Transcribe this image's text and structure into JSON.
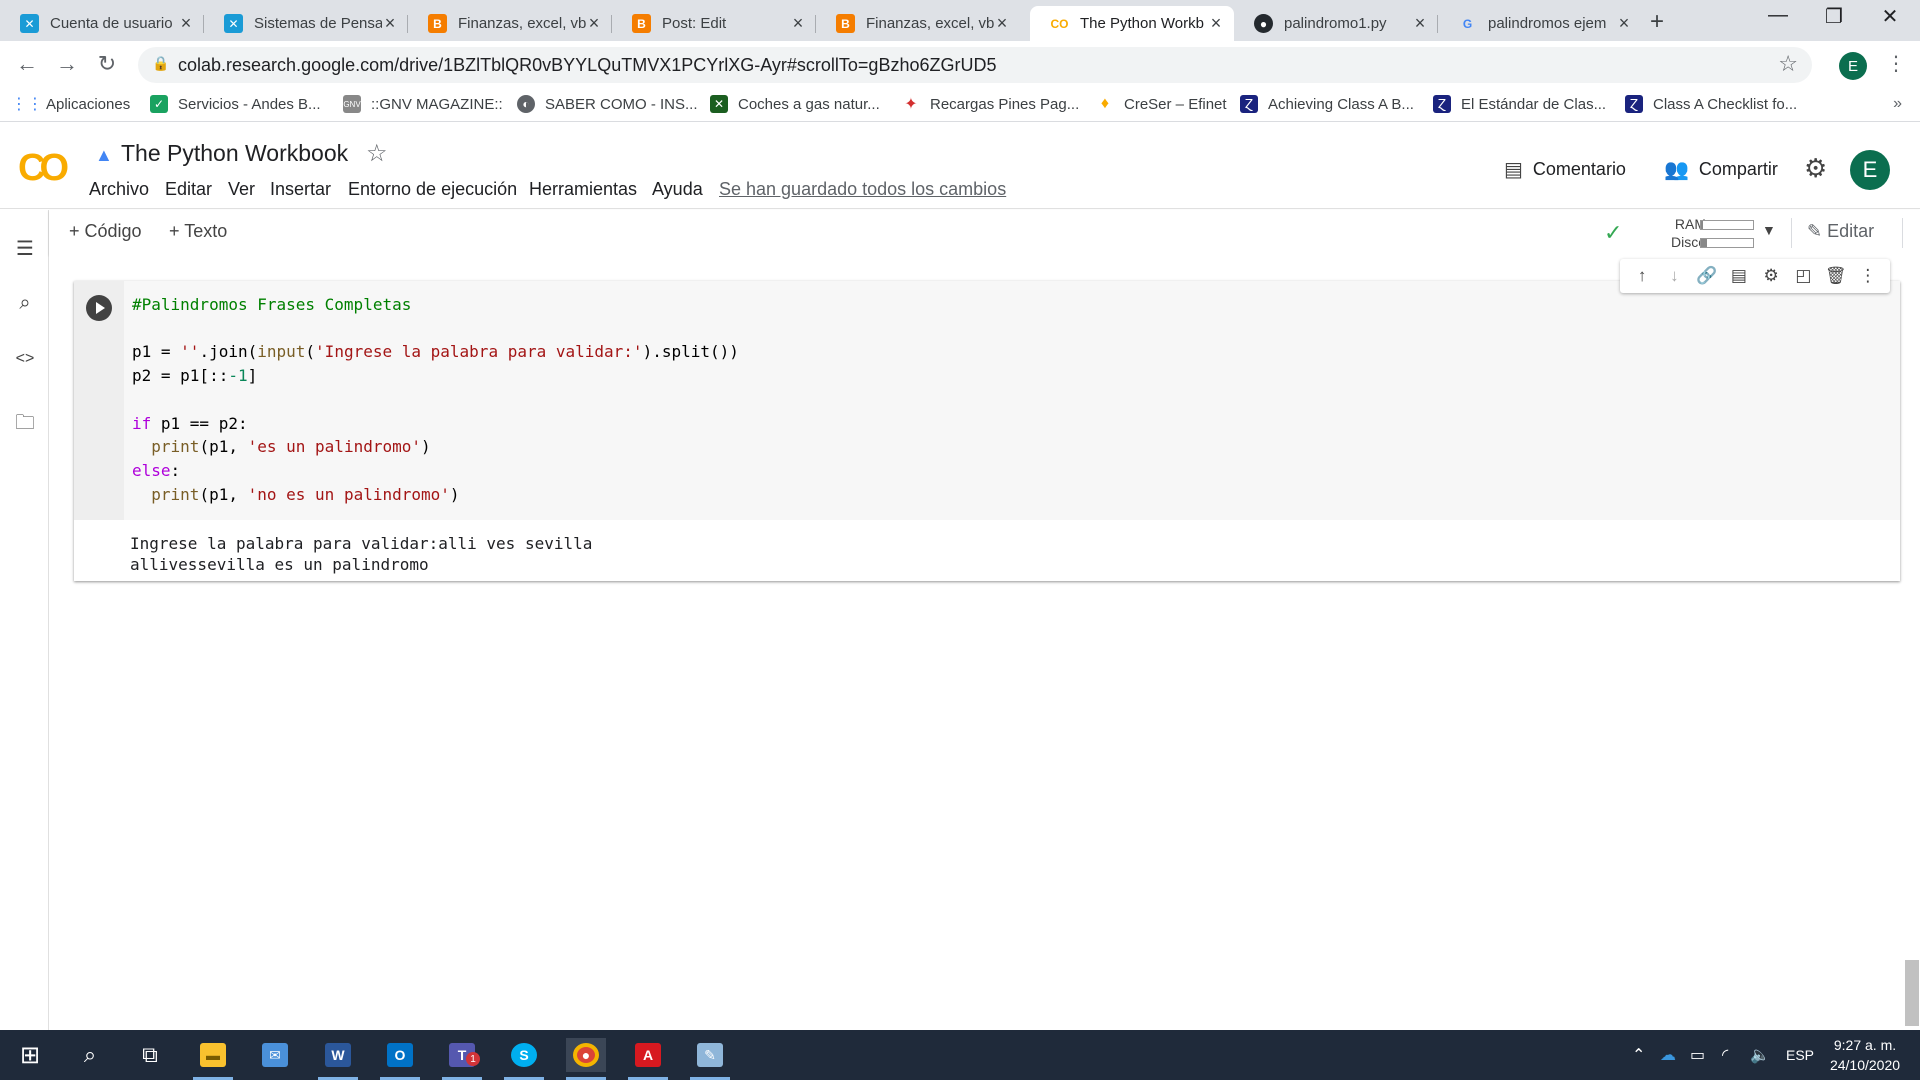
{
  "browser": {
    "tabs": [
      {
        "title": "Cuenta de usuario",
        "icon": "xinco-icon"
      },
      {
        "title": "Sistemas de Pensa",
        "icon": "xinco-icon"
      },
      {
        "title": "Finanzas, excel, vb",
        "icon": "blogger-icon"
      },
      {
        "title": "Post: Edit",
        "icon": "blogger-icon"
      },
      {
        "title": "Finanzas, excel, vb",
        "icon": "blogger-icon"
      },
      {
        "title": "The Python Workb",
        "icon": "colab-icon",
        "active": true
      },
      {
        "title": "palindromo1.py",
        "icon": "github-icon"
      },
      {
        "title": "palindromos ejem",
        "icon": "google-icon"
      }
    ],
    "url": "colab.research.google.com/drive/1BZlTblQR0vBYYLQuTMVX1PCYrlXG-Ayr#scrollTo=gBzho6ZGrUD5",
    "profile_initial": "E",
    "bookmarks": [
      "Aplicaciones",
      "Servicios - Andes B...",
      "::GNV MAGAZINE::",
      "SABER COMO - INS...",
      "Coches a gas natur...",
      "Recargas Pines Pag...",
      "CreSer – Efinet",
      "Achieving Class A B...",
      "El Estándar de Clas...",
      "Class A Checklist fo..."
    ],
    "bookmarks_more": "»"
  },
  "colab": {
    "logo": "CO",
    "title": "The Python Workbook",
    "menu": [
      "Archivo",
      "Editar",
      "Ver",
      "Insertar",
      "Entorno de ejecución",
      "Herramientas",
      "Ayuda"
    ],
    "saved_status": "Se han guardado todos los cambios",
    "comment_label": "Comentario",
    "share_label": "Compartir",
    "account_initial": "E",
    "toolbar": {
      "add_code": "+ Código",
      "add_text": "+ Texto",
      "ram_label": "RAM",
      "disk_label": "Disco",
      "ram_fill": 0.04,
      "disk_fill": 0.12,
      "edit_label": "Editar"
    }
  },
  "cell": {
    "code_lines": [
      "#Palindromos Frases Completas",
      "",
      "p1 = ''.join(input('Ingrese la palabra para validar:').split())",
      "p2 = p1[::-1]",
      "",
      "if p1 == p2:",
      "  print(p1, 'es un palindromo')",
      "else:",
      "  print(p1, 'no es un palindromo')"
    ],
    "output_lines": [
      "Ingrese la palabra para validar:alli ves sevilla",
      "allivessevilla es un palindromo"
    ]
  },
  "taskbar": {
    "language": "ESP",
    "time": "9:27 a. m.",
    "date": "24/10/2020",
    "teams_badge": "1"
  },
  "colors": {
    "colab_orange": "#f9ab00",
    "account_green": "#0b6e4f",
    "taskbar": "#1f2a3a"
  }
}
